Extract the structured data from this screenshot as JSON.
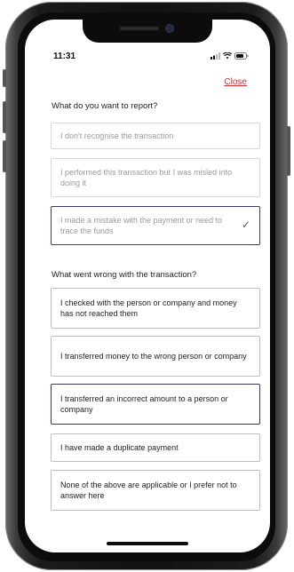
{
  "status": {
    "time": "11:31"
  },
  "header": {
    "close_label": "Close"
  },
  "report": {
    "question": "What do you want to report?",
    "options": [
      {
        "label": "I don't recognise the transaction"
      },
      {
        "label": "I performed this transaction but I was misled into doing it"
      },
      {
        "label": "I made a mistake with the payment or need to trace the funds",
        "selected": true
      }
    ]
  },
  "wrong": {
    "question": "What went wrong with the transaction?",
    "options": [
      {
        "label": "I checked with the person or company and money has not reached them"
      },
      {
        "label": "I transferred money to the wrong person or company"
      },
      {
        "label": "I transferred an incorrect amount to a person or company"
      },
      {
        "label": "I have made a duplicate payment"
      },
      {
        "label": "None of the above are applicable or I prefer not to answer here"
      }
    ]
  },
  "icons": {
    "signal": "signal-icon",
    "wifi": "wifi-icon",
    "battery": "battery-icon",
    "check": "checkmark-icon"
  },
  "colors": {
    "close": "#d0332f",
    "selected_border": "#3e3b66"
  }
}
